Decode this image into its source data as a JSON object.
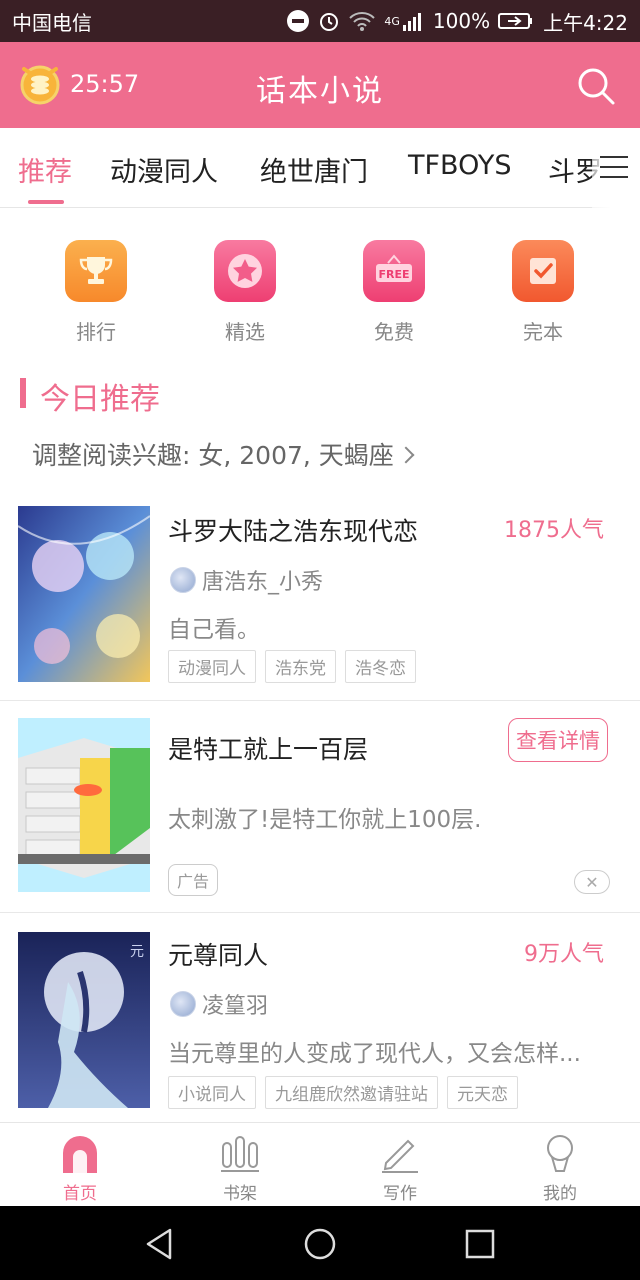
{
  "status_bar": {
    "carrier": "中国电信",
    "network": "4G",
    "battery": "100%",
    "time": "上午4:22"
  },
  "header": {
    "timer": "25:57",
    "title": "话本小说"
  },
  "tabs": [
    "推荐",
    "动漫同人",
    "绝世唐门",
    "TFBOYS",
    "斗罗"
  ],
  "quick_entries": [
    {
      "label": "排行",
      "icon": "trophy-icon",
      "color": "#f89a3a"
    },
    {
      "label": "精选",
      "icon": "star-icon",
      "color": "#f25d8a"
    },
    {
      "label": "免费",
      "icon": "free-icon",
      "color": "#f25d8a"
    },
    {
      "label": "完本",
      "icon": "check-icon",
      "color": "#f4703e"
    }
  ],
  "section": {
    "title": "今日推荐",
    "interest": "调整阅读兴趣: 女, 2007, 天蝎座"
  },
  "books": [
    {
      "title": "斗罗大陆之浩东现代恋",
      "popularity": "1875人气",
      "author": "唐浩东_小秀",
      "desc": "自己看。",
      "tags": [
        "动漫同人",
        "浩东党",
        "浩冬恋"
      ]
    },
    {
      "title": "元尊同人",
      "popularity": "9万人气",
      "author": "凌篁羽",
      "desc": "当元尊里的人变成了现代人，又会怎样...",
      "tags": [
        "小说同人",
        "九组鹿欣然邀请驻站",
        "元天恋"
      ]
    }
  ],
  "ad": {
    "title": "是特工就上一百层",
    "desc": "太刺激了!是特工你就上100层.",
    "button": "查看详情",
    "tag": "广告",
    "close": "✕"
  },
  "bottom_nav": [
    "首页",
    "书架",
    "写作",
    "我的"
  ],
  "colors": {
    "accent": "#ef6d8e",
    "statusbar": "#3a1f25"
  }
}
